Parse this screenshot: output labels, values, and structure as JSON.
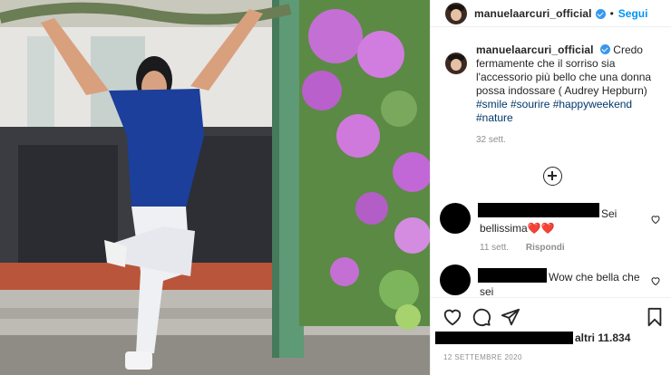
{
  "post": {
    "username": "manuelaarcuri_official",
    "separator": "•",
    "follow_label": "Segui",
    "caption": "Credo fermamente che il sorriso sia l'accessorio più bello che una donna possa indossare ( Audrey Hepburn)",
    "hashtags": "#smile #sourire #happyweekend #nature",
    "time_ago": "32 sett.",
    "likes_text": "altri 11.834",
    "date": "12 SETTEMBRE 2020"
  },
  "comments": [
    {
      "text": "Sei bellissima❤️❤️",
      "time": "11 sett.",
      "reply_label": "Rispondi"
    },
    {
      "text": "Wow che bella che sei"
    }
  ],
  "icons": [
    "heart-icon",
    "comment-icon",
    "share-icon",
    "bookmark-icon",
    "load-more-icon",
    "verified-icon"
  ],
  "colors": {
    "accent": "#0095f6",
    "verified": "#3897f0",
    "hashtag": "#00376b",
    "muted": "#8e8e8e"
  }
}
